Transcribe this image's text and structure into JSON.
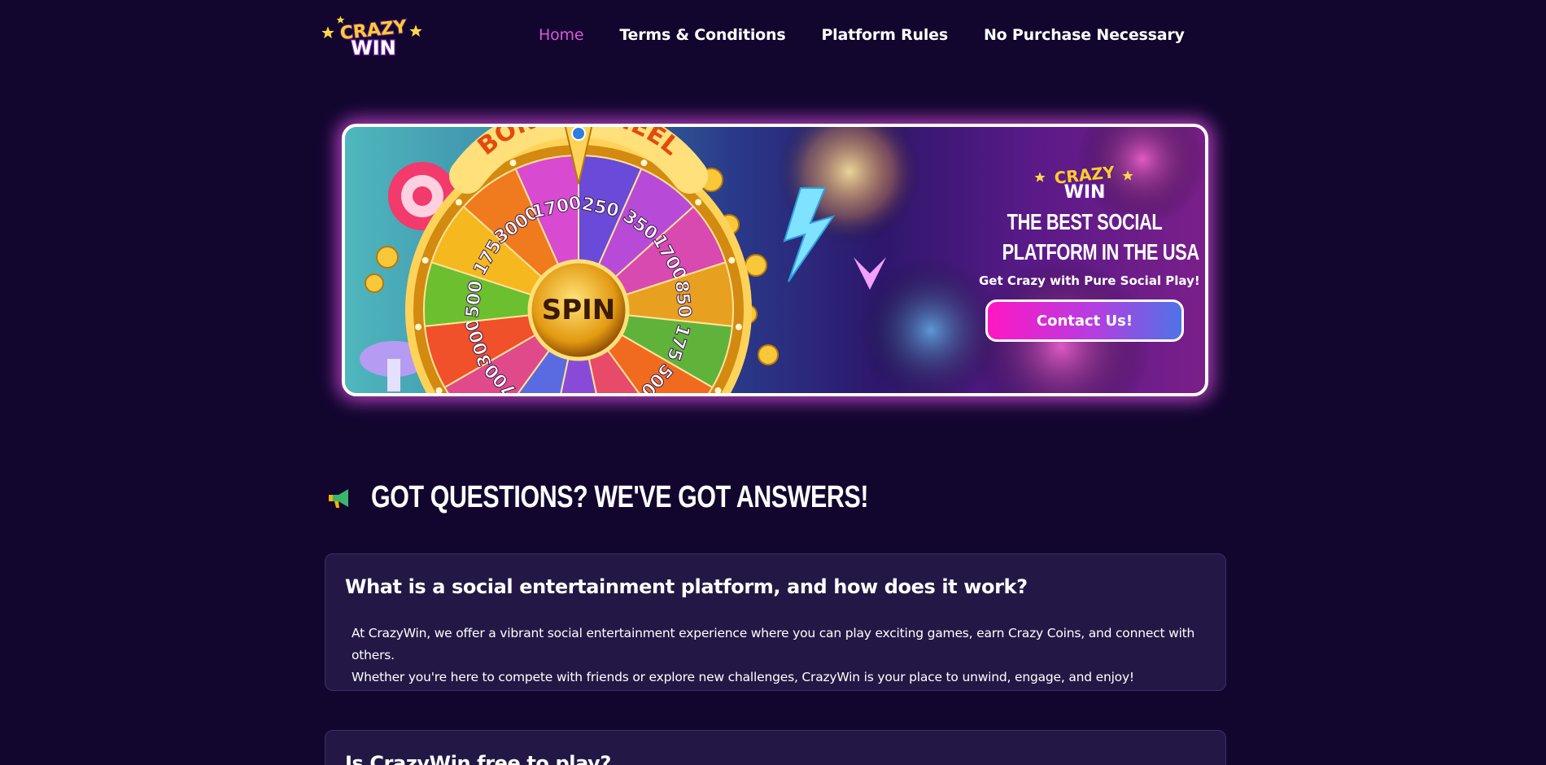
{
  "brand": {
    "logo_line1": "CRAZY",
    "logo_line2": "WIN"
  },
  "nav": {
    "items": [
      {
        "label": "Home",
        "active": true
      },
      {
        "label": "Terms & Conditions",
        "active": false
      },
      {
        "label": "Platform Rules",
        "active": false
      },
      {
        "label": "No Purchase Necessary",
        "active": false
      }
    ]
  },
  "banner": {
    "wheel_title": "BONUS WHEEL",
    "spin_label": "SPIN",
    "wheel_values": [
      "250",
      "350",
      "1700",
      "850",
      "175",
      "500",
      "850",
      "3",
      "25",
      "700",
      "3000",
      "500",
      "175",
      "3000",
      "1700"
    ],
    "logo_line1": "CRAZY",
    "logo_line2": "WIN",
    "headline_line1": "THE BEST SOCIAL",
    "headline_line2": "PLATFORM IN THE USA",
    "subtitle": "Get Crazy with Pure Social Play!",
    "cta_label": "Contact Us!"
  },
  "faq": {
    "heading": "GOT QUESTIONS? WE'VE GOT ANSWERS!",
    "heading_icon": "megaphone-icon",
    "items": [
      {
        "question": "What is a social entertainment platform, and how does it work?",
        "answer_line1": "At CrazyWin, we offer a vibrant social entertainment experience where you can play exciting games, earn Crazy Coins, and connect with others.",
        "answer_line2": "Whether you're here to compete with friends or explore new challenges, CrazyWin is your place to unwind, engage, and enjoy!"
      },
      {
        "question": "Is CrazyWin free to play?"
      }
    ]
  },
  "colors": {
    "page_bg": "#12062f",
    "nav_active": "#d85ad8",
    "card_bg": "#231845",
    "banner_glow": "#e250e4",
    "cta_gradient_start": "#ff17c4",
    "cta_gradient_end": "#4e73e6"
  }
}
